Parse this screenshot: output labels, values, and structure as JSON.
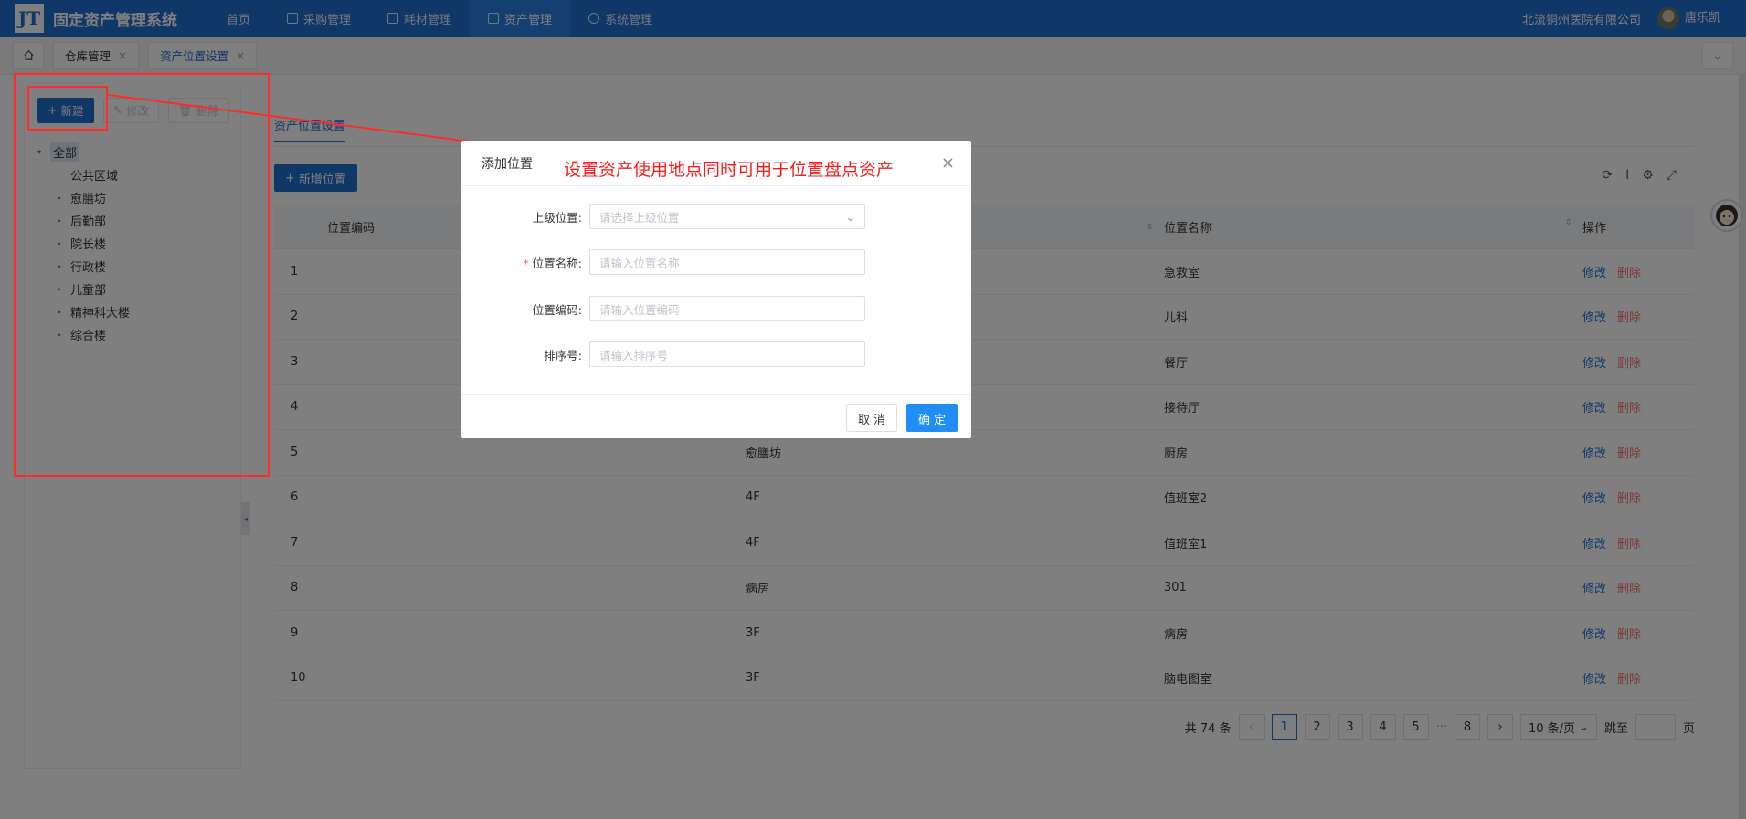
{
  "header": {
    "logo_text": "JT",
    "app_title": "固定资产管理系统",
    "nav": [
      {
        "label": "首页",
        "icon": "none"
      },
      {
        "label": "采购管理",
        "icon": "grid-icon"
      },
      {
        "label": "耗材管理",
        "icon": "box-icon"
      },
      {
        "label": "资产管理",
        "icon": "calendar-icon"
      },
      {
        "label": "系统管理",
        "icon": "gear-icon"
      }
    ],
    "company": "北流铜州医院有限公司",
    "username": "唐乐凯"
  },
  "tabs": {
    "items": [
      {
        "label": "仓库管理",
        "close": "×"
      },
      {
        "label": "资产位置设置",
        "close": "×"
      }
    ],
    "dropdown": "⌄"
  },
  "left": {
    "new_label": "新建",
    "edit_label": "修改",
    "delete_label": "删除",
    "tree": [
      {
        "label": "全部",
        "arrow": "▾"
      },
      {
        "label": "公共区域",
        "arrow": ""
      },
      {
        "label": "愈膳坊",
        "arrow": "▸"
      },
      {
        "label": "后勤部",
        "arrow": "▸"
      },
      {
        "label": "院长楼",
        "arrow": "▸"
      },
      {
        "label": "行政楼",
        "arrow": "▸"
      },
      {
        "label": "儿童部",
        "arrow": "▸"
      },
      {
        "label": "精神科大楼",
        "arrow": "▸"
      },
      {
        "label": "综合楼",
        "arrow": "▸"
      }
    ]
  },
  "main": {
    "sub_tab": "资产位置设置",
    "add_label": "新增位置",
    "columns": [
      "",
      "位置编码",
      "",
      "位置名称",
      "操作"
    ],
    "rows": [
      {
        "no": "1",
        "code": "",
        "parent": "",
        "name": "急救室"
      },
      {
        "no": "2",
        "code": "",
        "parent": "",
        "name": "儿科"
      },
      {
        "no": "3",
        "code": "",
        "parent": "",
        "name": "餐厅"
      },
      {
        "no": "4",
        "code": "",
        "parent": "",
        "name": "接待厅"
      },
      {
        "no": "5",
        "code": "",
        "parent": "愈膳坊",
        "name": "厨房"
      },
      {
        "no": "6",
        "code": "",
        "parent": "4F",
        "name": "值班室2"
      },
      {
        "no": "7",
        "code": "",
        "parent": "4F",
        "name": "值班室1"
      },
      {
        "no": "8",
        "code": "",
        "parent": "病房",
        "name": "301"
      },
      {
        "no": "9",
        "code": "",
        "parent": "3F",
        "name": "病房"
      },
      {
        "no": "10",
        "code": "",
        "parent": "3F",
        "name": "脑电图室"
      }
    ],
    "action_edit": "修改",
    "action_delete": "删除",
    "pagination": {
      "total": "共 74 条",
      "pages": [
        "1",
        "2",
        "3",
        "4",
        "5",
        "···",
        "8"
      ],
      "current": "1",
      "page_size": "10 条/页",
      "jump_label": "跳至",
      "page_unit": "页"
    }
  },
  "dialog": {
    "title": "添加位置",
    "close": "×",
    "fields": [
      {
        "label": "上级位置:",
        "placeholder": "请选择上级位置",
        "required": false
      },
      {
        "label": "位置名称:",
        "placeholder": "请输入位置名称",
        "required": true
      },
      {
        "label": "位置编码:",
        "placeholder": "请输入位置编码",
        "required": false
      },
      {
        "label": "排序号:",
        "placeholder": "请输入排序号",
        "required": false
      }
    ],
    "cancel": "取 消",
    "ok": "确 定"
  },
  "annotation": {
    "text": "设置资产使用地点同时可用于位置盘点资产",
    "color": "#ff2a2a"
  },
  "colors": {
    "primary": "#1f6fd1",
    "danger": "#f56c6c"
  }
}
